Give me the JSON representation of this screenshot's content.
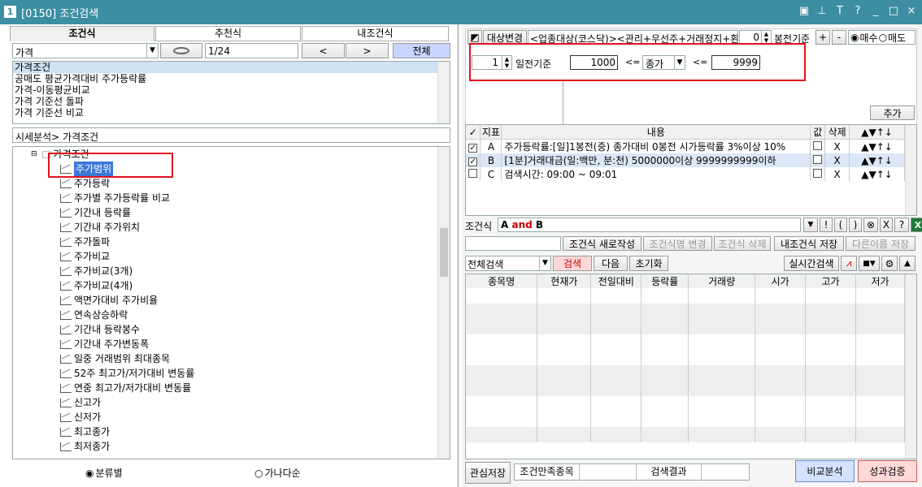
{
  "window": {
    "number": "1",
    "title": "[0150] 조건검색"
  },
  "left": {
    "tabs": [
      "조건식",
      "추천식",
      "내조건식"
    ],
    "search": {
      "value": "가격",
      "page": "1/24",
      "prev": "<",
      "next": ">",
      "all": "전체"
    },
    "conditions": [
      "가격조건",
      "공매도 평균가격대비 주가등락률",
      "가격-이동평균비교",
      "가격 기준선 돌파",
      "가격 기준선 비교"
    ],
    "breadcrumb": "시세분석> 가격조건",
    "tree_root": "가격조건",
    "tree_items": [
      "주가범위",
      "주가등락",
      "주가별 주가등락률 비교",
      "기간내 등락률",
      "기간내 주가위치",
      "주가돌파",
      "주가비교",
      "주가비교(3개)",
      "주가비교(4개)",
      "액면가대비 주가비율",
      "연속상승하락",
      "기간내 등락봉수",
      "기간내 주가변동폭",
      "일중 거래범위 최대종목",
      "52주 최고가/저가대비 변동률",
      "연중 최고가/저가대비 변동률",
      "신고가",
      "신저가",
      "최고종가",
      "최저종가"
    ],
    "radio1": "분류별",
    "radio2": "가나다순"
  },
  "right": {
    "top": {
      "target_btn": "대상변경",
      "target_text": "<업종대상(코스닥)><관리+우선주+거래정지+환",
      "num": "0",
      "bong": "봉전기준",
      "plus": "+",
      "minus": "-",
      "buy": "매수",
      "sell": "매도"
    },
    "param": {
      "days": "1",
      "day_label": "일전기준",
      "val1": "1000",
      "le": "<=",
      "field": "종가",
      "val2": "9999"
    },
    "add": "추가",
    "grid_headers": [
      "지표",
      "내용",
      "값",
      "삭제"
    ],
    "rows": [
      {
        "checked": true,
        "id": "A",
        "content": "주가등락률:[일]1봉전(중) 종가대비 0봉전 시가등락률 3%이상 10%"
      },
      {
        "checked": true,
        "id": "B",
        "content": "[1분]거래대금(일:백만, 분:천) 5000000이상 9999999999이하"
      },
      {
        "checked": false,
        "id": "C",
        "content": "검색시간: 09:00 ~ 09:01"
      }
    ],
    "del": "X",
    "expr_label": "조건식",
    "expr_a": "A",
    "expr_and": "and",
    "expr_b": "B",
    "expr_btns": [
      "!",
      "(",
      ")",
      "⊗",
      "X",
      "?"
    ],
    "actions": [
      "조건식 새로작성",
      "조건식명 변경",
      "조건식 삭제",
      "내조건식 저장",
      "다른이름 저장"
    ],
    "search_sel": "전체검색",
    "search_btn": "검색",
    "next_btn": "다음",
    "reset_btn": "초기화",
    "realtime": "실시간검색",
    "result_headers": [
      "종목명",
      "현재가",
      "전일대비",
      "등락률",
      "거래량",
      "시가",
      "고가",
      "저가"
    ],
    "bottom": {
      "save": "관심저장",
      "label1": "조건만족종목",
      "label2": "검색결과",
      "compare": "비교분석",
      "verify": "성과검증"
    }
  }
}
